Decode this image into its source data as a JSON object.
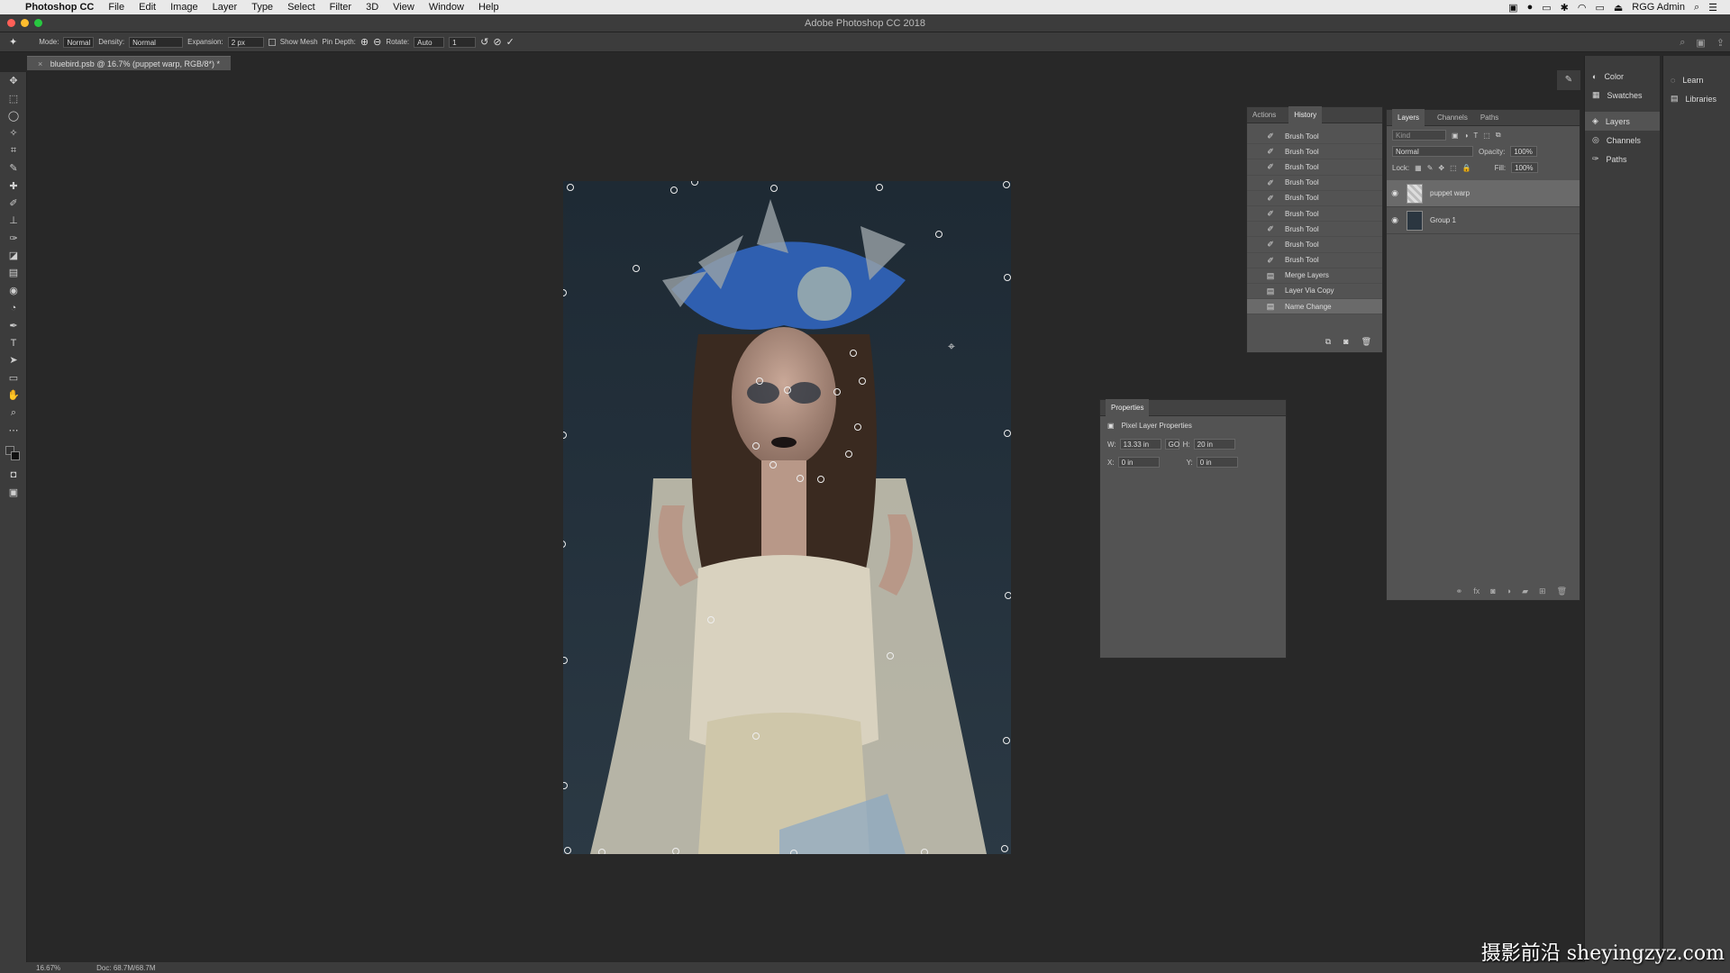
{
  "menubar": {
    "app_name": "Photoshop CC",
    "items": [
      "File",
      "Edit",
      "Image",
      "Layer",
      "Type",
      "Select",
      "Filter",
      "3D",
      "View",
      "Window",
      "Help"
    ],
    "user": "RGG Admin"
  },
  "window": {
    "title": "Adobe Photoshop CC 2018"
  },
  "options": {
    "mode_label": "Mode:",
    "mode_value": "Normal",
    "density_label": "Density:",
    "density_value": "Normal",
    "expansion_label": "Expansion:",
    "expansion_value": "2 px",
    "show_mesh_label": "Show Mesh",
    "pin_depth_label": "Pin Depth:",
    "rotate_label": "Rotate:",
    "rotate_value": "Auto",
    "rotate_angle": "1"
  },
  "document": {
    "tab_title": "bluebird.psb @ 16.7% (puppet warp, RGB/8*) *"
  },
  "history_panel": {
    "tabs": [
      "Actions",
      "History"
    ],
    "items": [
      {
        "label": "Brush Tool",
        "icon": "brush-icon"
      },
      {
        "label": "Brush Tool",
        "icon": "brush-icon"
      },
      {
        "label": "Brush Tool",
        "icon": "brush-icon"
      },
      {
        "label": "Brush Tool",
        "icon": "brush-icon"
      },
      {
        "label": "Brush Tool",
        "icon": "brush-icon"
      },
      {
        "label": "Brush Tool",
        "icon": "brush-icon"
      },
      {
        "label": "Brush Tool",
        "icon": "brush-icon"
      },
      {
        "label": "Brush Tool",
        "icon": "brush-icon"
      },
      {
        "label": "Brush Tool",
        "icon": "brush-icon"
      },
      {
        "label": "Merge Layers",
        "icon": "layer-icon"
      },
      {
        "label": "Layer Via Copy",
        "icon": "layer-icon"
      },
      {
        "label": "Name Change",
        "icon": "layer-icon"
      }
    ]
  },
  "layers_panel": {
    "tabs": [
      "Layers",
      "Channels",
      "Paths"
    ],
    "filter_placeholder": "Kind",
    "blend_mode": "Normal",
    "opacity_label": "Opacity:",
    "opacity_value": "100%",
    "lock_label": "Lock:",
    "fill_label": "Fill:",
    "fill_value": "100%",
    "layers": [
      {
        "name": "puppet warp"
      },
      {
        "name": "Group 1"
      }
    ]
  },
  "properties_panel": {
    "title": "Properties",
    "subtitle": "Pixel Layer Properties",
    "w_label": "W:",
    "w_value": "13.33 in",
    "link_label": "GO",
    "h_label": "H:",
    "h_value": "20 in",
    "x_label": "X:",
    "x_value": "0 in",
    "y_label": "Y:",
    "y_value": "0 in"
  },
  "dock_mid": {
    "items": [
      "Color",
      "Swatches",
      "Layers",
      "Channels",
      "Paths"
    ]
  },
  "dock_right": {
    "items": [
      "Learn",
      "Libraries"
    ]
  },
  "status": {
    "zoom": "16.67%",
    "doc": "Doc: 68.7M/68.7M"
  },
  "watermark": "摄影前沿 sheyingzyz.com",
  "colors": {
    "accent_close": "#ff5f57",
    "accent_min": "#febc2e",
    "accent_max": "#28c840"
  }
}
